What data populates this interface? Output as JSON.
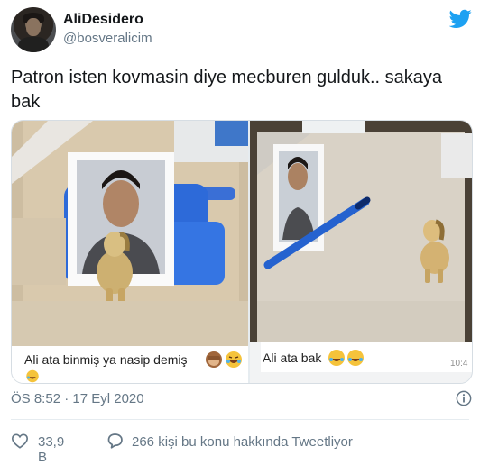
{
  "author": {
    "display_name": "AliDesidero",
    "handle": "@bosveralicim"
  },
  "tweet": {
    "text": "Patron isten kovmasin diye mecburen gulduk.. sakaya bak"
  },
  "media": {
    "left_caption": "Ali ata binmiş ya nasip demiş",
    "left_emojis": [
      "see-no-evil-monkey",
      "rolling-laughing",
      "rolling-laughing"
    ],
    "right_caption": "Ali ata bak",
    "right_emojis": [
      "rolling-laughing",
      "rolling-laughing"
    ],
    "right_time": "10:4"
  },
  "meta": {
    "timestamp": "ÖS 8:52 · 17 Eyl 2020"
  },
  "actions": {
    "like_count": "33,9 B",
    "reply_text": "266 kişi bu konu hakkında Tweetliyor"
  },
  "colors": {
    "twitter_blue": "#1da1f2",
    "secondary_text": "#657786",
    "primary_text": "#14171a"
  }
}
